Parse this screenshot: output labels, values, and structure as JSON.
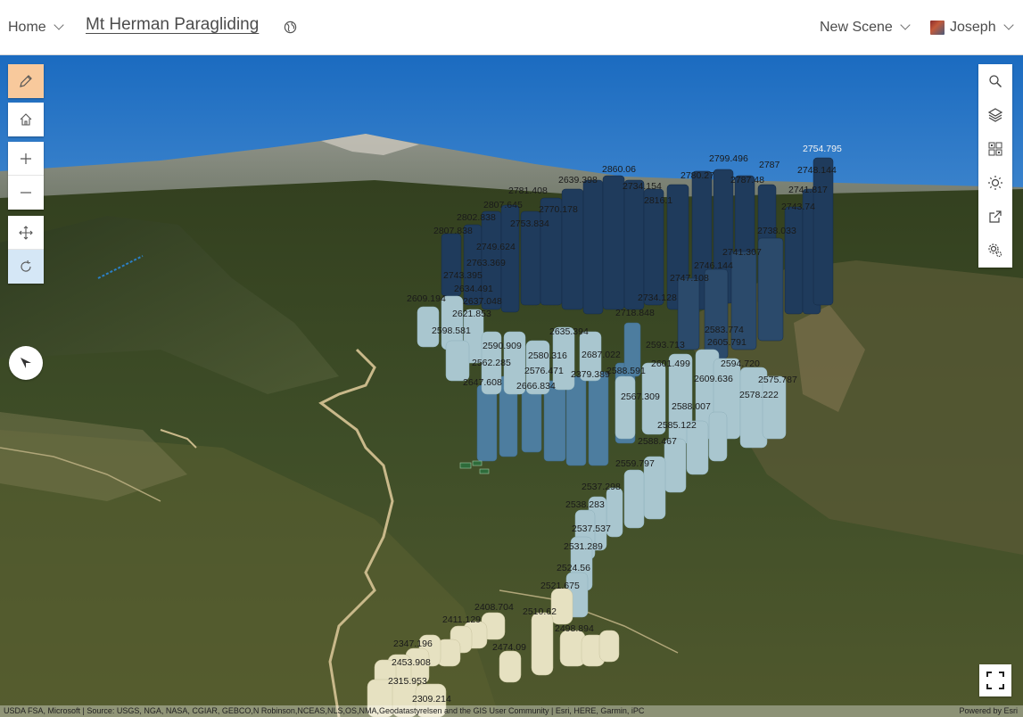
{
  "header": {
    "home_label": "Home",
    "title": "Mt Herman Paragliding",
    "new_scene_label": "New Scene",
    "user_name": "Joseph"
  },
  "left_controls": [
    "pencil-icon",
    "home-icon",
    "zoom-in-icon",
    "zoom-out-icon",
    "pan-icon",
    "rotate-icon"
  ],
  "compass_icon": "compass-icon",
  "right_tools": [
    "search-icon",
    "layers-icon",
    "basemap-gallery-icon",
    "daylight-icon",
    "share-icon",
    "settings-icon"
  ],
  "fullscreen_icon": "fullscreen-icon",
  "attribution": {
    "sources": "USDA FSA, Microsoft | Source: USGS, NGA, NASA, CGIAR, GEBCO,N Robinson,NCEAS,NLS,OS,NMA,Geodatastyrelsen and the GIS User Community | Esri, HERE, Garmin, iPC",
    "powered_by": "Powered by Esri"
  },
  "elevation_labels": [
    "2754.795",
    "2799.496",
    "2787",
    "2780.27",
    "2860.06",
    "2748.144",
    "2741.817",
    "2743.74",
    "2738.033",
    "2741.307",
    "2746.144",
    "2747.108",
    "2734.128",
    "2718.848",
    "2753.834",
    "2770.178",
    "2781.408",
    "2807.645",
    "2802.838",
    "2807.838",
    "2749.624",
    "2763.369",
    "2743.395",
    "2634.491",
    "2637.048",
    "2609.194",
    "2621.853",
    "2598.581",
    "2580.316",
    "2576.471",
    "2666.834",
    "2647.608",
    "2562.285",
    "2590.909",
    "2687.022",
    "2609.636",
    "2594.720",
    "2605.791",
    "2583.774",
    "2588.007",
    "2585.122",
    "2588.467",
    "2567.309",
    "2578.222",
    "2575.787",
    "2559.797",
    "2537.298",
    "2538.283",
    "2537.537",
    "2531.289",
    "2524.56",
    "2521.675",
    "2510.62",
    "2498.894",
    "2474.09",
    "2408.704",
    "2411.129",
    "2347.196",
    "2453.908",
    "2315.953",
    "2309.214",
    "2601.499",
    "2593.713",
    "2588.591",
    "2379.389",
    "2734.154",
    "2787.48",
    "2816.1",
    "2639.398",
    "2635.394"
  ],
  "colors": {
    "accent": "#f8c99c",
    "selected": "#d5e7f6",
    "dark_bar": "#1f3b5c",
    "mid_bar": "#4a7a9e",
    "light_bar": "#a9c6cf",
    "pale_bar": "#e6e1c1"
  }
}
